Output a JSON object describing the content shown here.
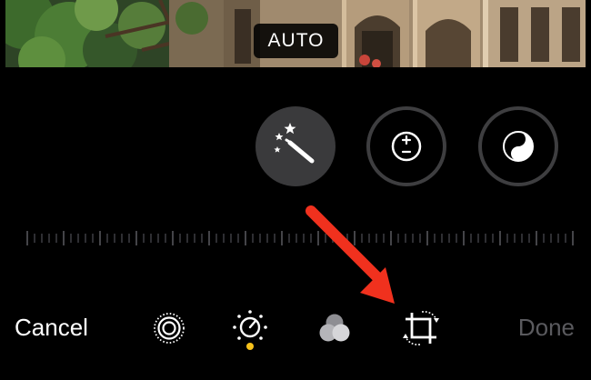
{
  "photo": {
    "mode_badge": "AUTO"
  },
  "adjustments": [
    {
      "name": "auto-enhance",
      "icon": "magic-wand-icon",
      "selected": true
    },
    {
      "name": "exposure",
      "icon": "plus-minus-icon",
      "selected": false
    },
    {
      "name": "black-and-white",
      "icon": "yin-yang-icon",
      "selected": false
    }
  ],
  "toolbar": {
    "cancel_label": "Cancel",
    "done_label": "Done",
    "tools": [
      {
        "name": "live-photo",
        "icon": "live-photo-icon"
      },
      {
        "name": "adjust",
        "icon": "adjust-dial-icon",
        "active": true
      },
      {
        "name": "filters",
        "icon": "filters-icon"
      },
      {
        "name": "crop",
        "icon": "crop-rotate-icon"
      }
    ]
  },
  "colors": {
    "background": "#000000",
    "selected_button": "#3a3a3c",
    "button_ring": "#3e3e40",
    "active_dot": "#f7c21b",
    "annotation_arrow": "#f0311e",
    "done_disabled": "#5a5a5e"
  }
}
